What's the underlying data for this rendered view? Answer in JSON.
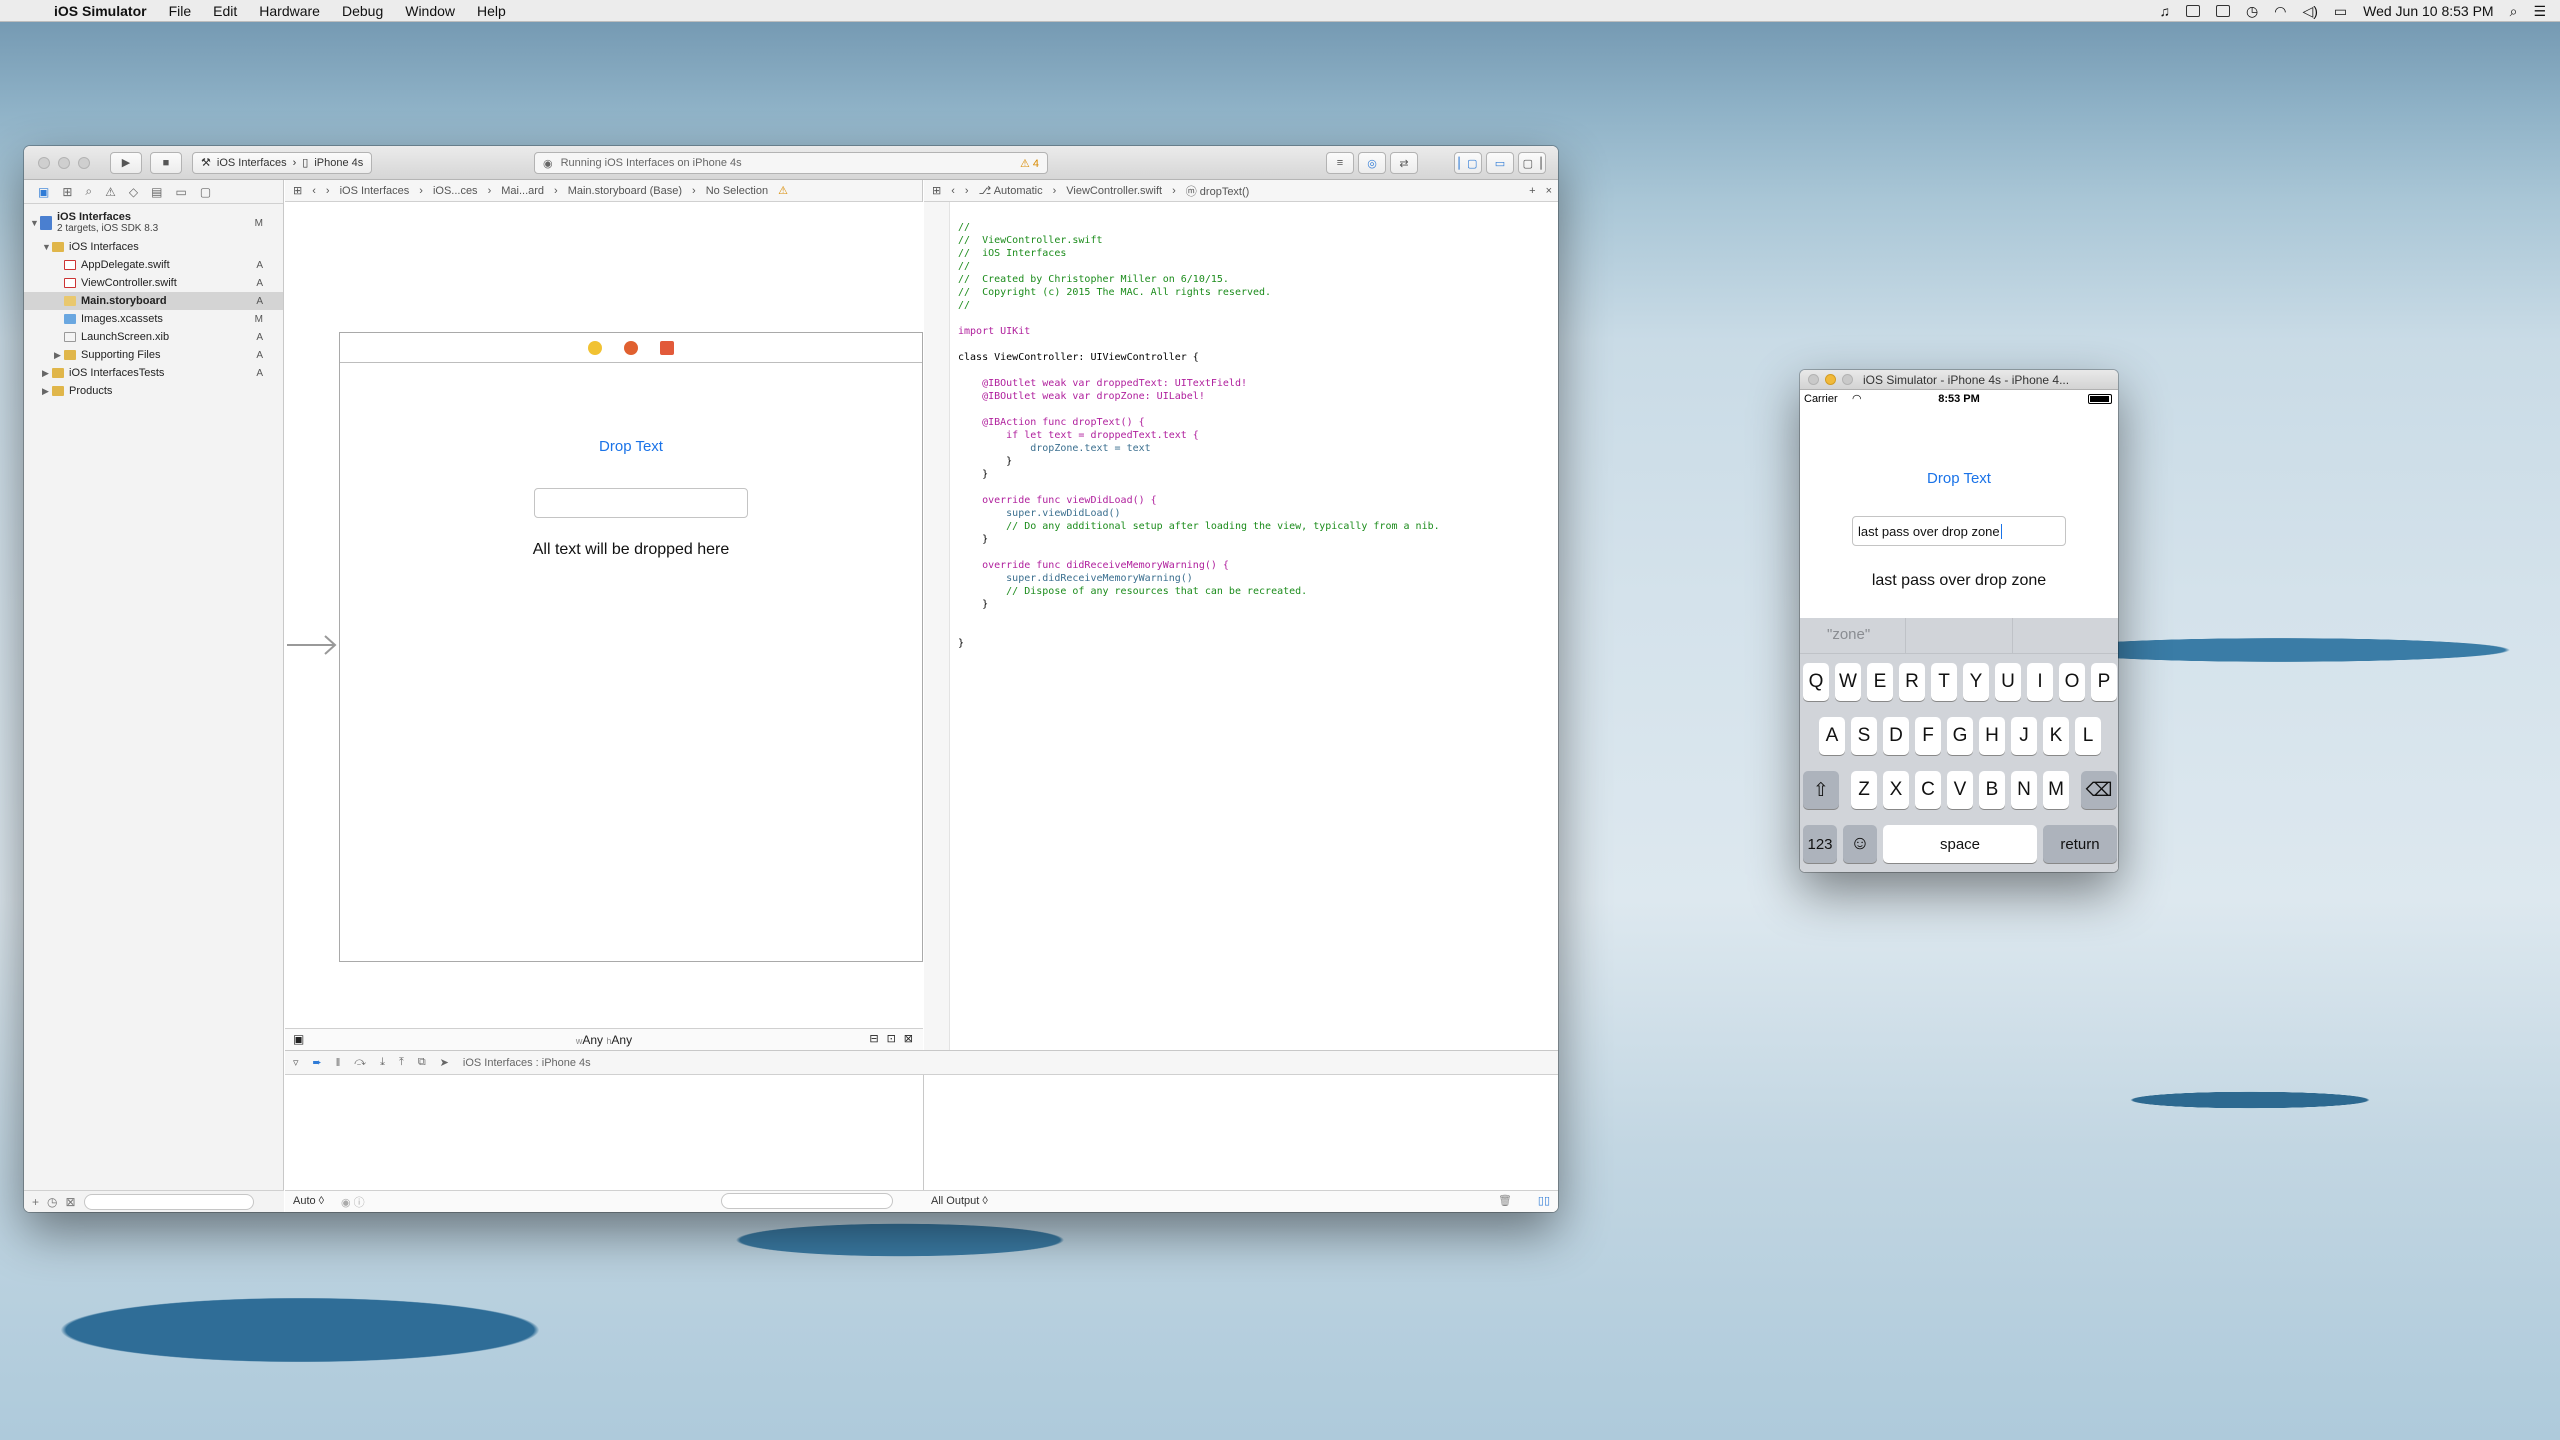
{
  "menubar": {
    "app": "iOS Simulator",
    "items": [
      "File",
      "Edit",
      "Hardware",
      "Debug",
      "Window",
      "Help"
    ],
    "clock": "Wed Jun 10  8:53 PM"
  },
  "xcode": {
    "scheme_target": "iOS Interfaces",
    "scheme_device": "iPhone 4s",
    "activity": "Running iOS Interfaces on iPhone 4s",
    "warnings": "4",
    "project_tree": [
      {
        "name": "iOS Interfaces",
        "sub": "2 targets, iOS SDK 8.3",
        "status": "M",
        "icon": "proj",
        "level": 0
      },
      {
        "name": "iOS Interfaces",
        "status": "",
        "icon": "folder",
        "level": 1
      },
      {
        "name": "AppDelegate.swift",
        "status": "A",
        "icon": "swift",
        "level": 2
      },
      {
        "name": "ViewController.swift",
        "status": "A",
        "icon": "swift",
        "level": 2
      },
      {
        "name": "Main.storyboard",
        "status": "A",
        "icon": "sb",
        "level": 2,
        "selected": true
      },
      {
        "name": "Images.xcassets",
        "status": "M",
        "icon": "xcas",
        "level": 2
      },
      {
        "name": "LaunchScreen.xib",
        "status": "A",
        "icon": "xib",
        "level": 2
      },
      {
        "name": "Supporting Files",
        "status": "A",
        "icon": "folder",
        "level": 2
      },
      {
        "name": "iOS InterfacesTests",
        "status": "A",
        "icon": "folder",
        "level": 1
      },
      {
        "name": "Products",
        "status": "",
        "icon": "folder",
        "level": 1
      }
    ],
    "ib_jumpbar": [
      "iOS Interfaces",
      "iOS...ces",
      "Mai...ard",
      "Main.storyboard (Base)",
      "No Selection"
    ],
    "editor_jumpbar": [
      "Automatic",
      "ViewController.swift",
      "dropText()"
    ],
    "ib_scene": {
      "button": "Drop Text",
      "label": "All text will be dropped here"
    },
    "size_class": {
      "w_prefix": "w",
      "w": "Any",
      "h_prefix": "h",
      "h": "Any"
    },
    "debug_scheme": "iOS Interfaces : iPhone 4s",
    "debug_auto": "Auto ◊",
    "debug_output": "All Output ◊"
  },
  "code_lines": [
    "//",
    "//  ViewController.swift",
    "//  iOS Interfaces",
    "//",
    "//  Created by Christopher Miller on 6/10/15.",
    "//  Copyright (c) 2015 The MAC. All rights reserved.",
    "//",
    "",
    "import UIKit",
    "",
    "class ViewController: UIViewController {",
    "",
    "    @IBOutlet weak var droppedText: UITextField!",
    "    @IBOutlet weak var dropZone: UILabel!",
    "",
    "    @IBAction func dropText() {",
    "        if let text = droppedText.text {",
    "            dropZone.text = text",
    "        }",
    "    }",
    "",
    "    override func viewDidLoad() {",
    "        super.viewDidLoad()",
    "        // Do any additional setup after loading the view, typically from a nib.",
    "    }",
    "",
    "    override func didReceiveMemoryWarning() {",
    "        super.didReceiveMemoryWarning()",
    "        // Dispose of any resources that can be recreated.",
    "    }",
    "",
    "",
    "}"
  ],
  "simulator": {
    "title": "iOS Simulator - iPhone 4s - iPhone 4...",
    "carrier": "Carrier",
    "time": "8:53 PM",
    "button": "Drop Text",
    "field_value": "last pass over drop zone",
    "label": "last pass over drop zone",
    "suggestions": [
      "\"zone\"",
      "",
      ""
    ],
    "keyboard": {
      "row1": [
        "Q",
        "W",
        "E",
        "R",
        "T",
        "Y",
        "U",
        "I",
        "O",
        "P"
      ],
      "row2": [
        "A",
        "S",
        "D",
        "F",
        "G",
        "H",
        "J",
        "K",
        "L"
      ],
      "row3": [
        "Z",
        "X",
        "C",
        "V",
        "B",
        "N",
        "M"
      ],
      "numbers": "123",
      "space": "space",
      "return": "return"
    }
  }
}
